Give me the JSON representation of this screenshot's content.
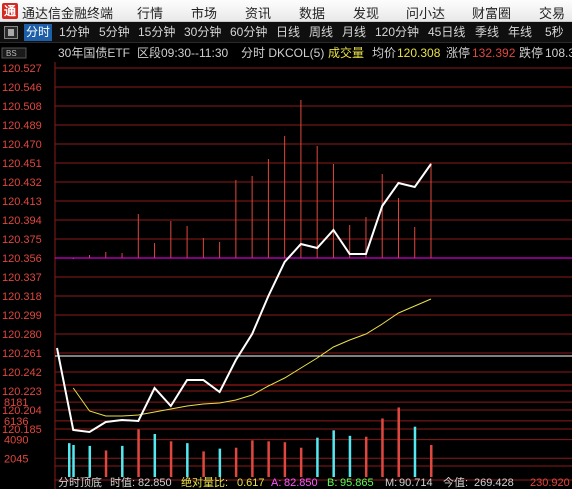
{
  "app": {
    "logo_char": "通",
    "name": "通达信金融终端"
  },
  "menu": [
    {
      "label": "行情"
    },
    {
      "label": "市场"
    },
    {
      "label": "资讯"
    },
    {
      "label": "数据"
    },
    {
      "label": "发现"
    },
    {
      "label": "问小达"
    },
    {
      "label": "财富圈"
    },
    {
      "label": "交易"
    }
  ],
  "periods": [
    {
      "label": "分时",
      "active": true
    },
    {
      "label": "1分钟"
    },
    {
      "label": "5分钟"
    },
    {
      "label": "15分钟"
    },
    {
      "label": "30分钟"
    },
    {
      "label": "60分钟"
    },
    {
      "label": "日线"
    },
    {
      "label": "周线"
    },
    {
      "label": "月线"
    },
    {
      "label": "120分钟"
    },
    {
      "label": "45日线"
    },
    {
      "label": "季线"
    },
    {
      "label": "年线"
    },
    {
      "label": "5秒"
    }
  ],
  "panel_tag": "BS",
  "info": {
    "name": "30年国债ETF",
    "session": "区段09:30--11:30",
    "indicator": "分时 DKCOL(5)",
    "volume_label": "成交量",
    "avg_label": "均价",
    "avg_value": "120.308",
    "limit_up_label": "涨停",
    "limit_up_value": "132.392",
    "limit_down_label": "跌停",
    "limit_down_value": "108.3"
  },
  "bottom": {
    "label1": "分时顶底",
    "label2": "时值:",
    "val2": "82.850",
    "label3": "绝对量比:",
    "val3": "0.617",
    "labelA": "A:",
    "valA": "82.850",
    "labelB": "B:",
    "valB": "95.865",
    "labelM": "M:",
    "valM": "90.714",
    "label4": "今值:",
    "val4": "269.428",
    "val5": "230.920"
  },
  "colors": {
    "price_line": "#ffffff",
    "avg_line": "#e8e04a",
    "baseline": "#ff00ff",
    "grid": "#8c1a1a",
    "axis_text": "#e0473e",
    "up_bar": "#e0473e",
    "down_bar": "#54e8f0"
  },
  "chart_data": {
    "type": "line",
    "price_ticks": [
      "120.527",
      "120.546",
      "120.508",
      "120.489",
      "120.470",
      "120.451",
      "120.432",
      "120.413",
      "120.394",
      "120.375",
      "120.356",
      "120.337",
      "120.318",
      "120.299",
      "120.280",
      "120.261",
      "120.242",
      "120.223",
      "120.204",
      "120.185"
    ],
    "volume_ticks": [
      "8181",
      "6136",
      "4090",
      "2045"
    ],
    "price_range": [
      120.185,
      120.546
    ],
    "reference_price": 120.356,
    "price_series": [
      120.266,
      120.184,
      120.182,
      120.192,
      120.194,
      120.193,
      120.226,
      120.208,
      120.234,
      120.234,
      120.222,
      120.254,
      120.28,
      120.318,
      120.352,
      120.37,
      120.366,
      120.384,
      120.36,
      120.36,
      120.408,
      120.431,
      120.427,
      120.45
    ],
    "avg_series": [
      null,
      120.226,
      120.203,
      120.198,
      120.198,
      120.199,
      120.202,
      120.205,
      120.208,
      120.21,
      120.211,
      120.214,
      120.219,
      120.228,
      120.236,
      120.246,
      120.256,
      120.267,
      120.274,
      120.28,
      120.29,
      120.301,
      120.308,
      120.315
    ],
    "indicator_bars": [
      120.356,
      120.355,
      120.359,
      120.362,
      120.361,
      120.4,
      120.371,
      120.393,
      120.388,
      120.376,
      120.372,
      120.434,
      120.438,
      120.455,
      120.478,
      120.514,
      120.468,
      120.45,
      120.389,
      120.397,
      120.44,
      120.416,
      120.387,
      120.451
    ],
    "volume_range": [
      0,
      9400
    ],
    "volume_bars": [
      {
        "v": 3700,
        "dir": "down"
      },
      {
        "v": 3500,
        "dir": "down"
      },
      {
        "v": 3400,
        "dir": "down"
      },
      {
        "v": 2900,
        "dir": "up"
      },
      {
        "v": 3400,
        "dir": "down"
      },
      {
        "v": 5200,
        "dir": "up"
      },
      {
        "v": 4700,
        "dir": "down"
      },
      {
        "v": 3900,
        "dir": "up"
      },
      {
        "v": 3700,
        "dir": "down"
      },
      {
        "v": 2800,
        "dir": "up"
      },
      {
        "v": 3100,
        "dir": "down"
      },
      {
        "v": 3200,
        "dir": "up"
      },
      {
        "v": 4000,
        "dir": "up"
      },
      {
        "v": 3900,
        "dir": "up"
      },
      {
        "v": 3800,
        "dir": "up"
      },
      {
        "v": 3200,
        "dir": "up"
      },
      {
        "v": 4300,
        "dir": "down"
      },
      {
        "v": 5100,
        "dir": "down"
      },
      {
        "v": 4500,
        "dir": "down"
      },
      {
        "v": 4400,
        "dir": "up"
      },
      {
        "v": 6400,
        "dir": "up"
      },
      {
        "v": 7600,
        "dir": "up"
      },
      {
        "v": 5500,
        "dir": "down"
      },
      {
        "v": 3500,
        "dir": "up"
      }
    ]
  }
}
